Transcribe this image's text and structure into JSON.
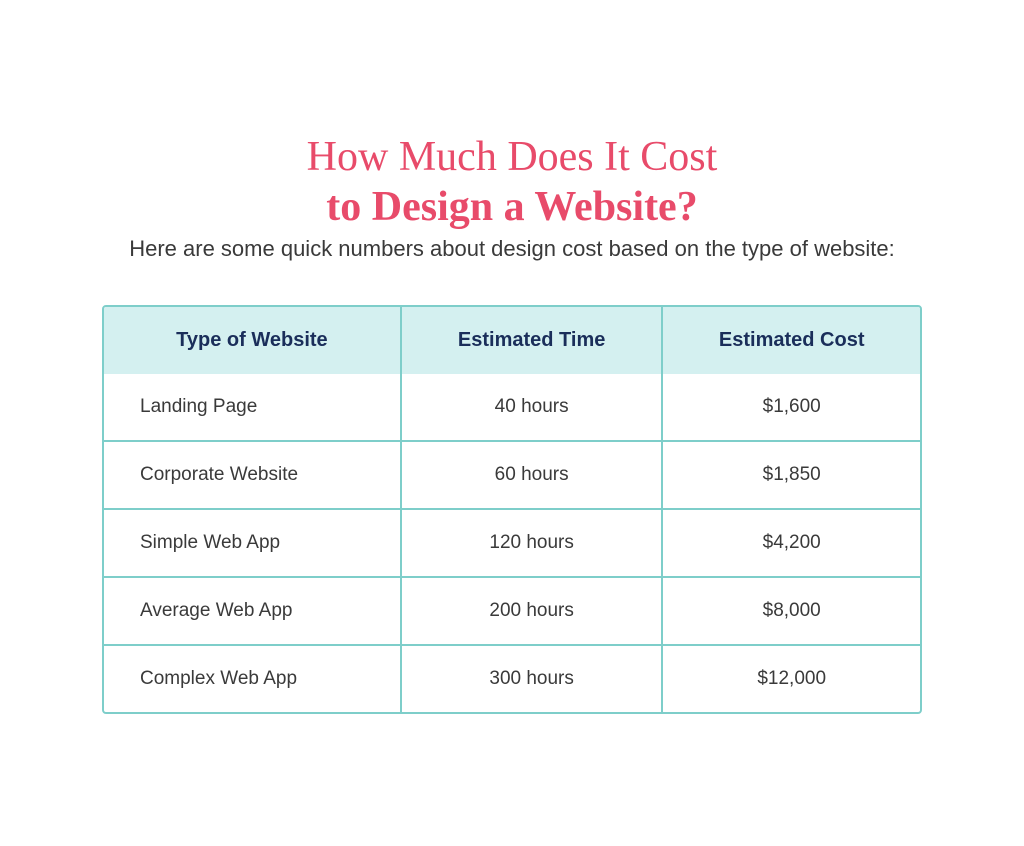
{
  "header": {
    "title_line1": "How Much Does It Cost",
    "title_line2": "to Design a Website?",
    "subtitle": "Here are some quick numbers about design cost based on the type of website:"
  },
  "table": {
    "columns": [
      {
        "label": "Type of Website"
      },
      {
        "label": "Estimated Time"
      },
      {
        "label": "Estimated Cost"
      }
    ],
    "rows": [
      {
        "type": "Landing Page",
        "time": "40 hours",
        "cost": "$1,600"
      },
      {
        "type": "Corporate Website",
        "time": "60 hours",
        "cost": "$1,850"
      },
      {
        "type": "Simple Web App",
        "time": "120 hours",
        "cost": "$4,200"
      },
      {
        "type": "Average Web App",
        "time": "200 hours",
        "cost": "$8,000"
      },
      {
        "type": "Complex Web App",
        "time": "300 hours",
        "cost": "$12,000"
      }
    ]
  }
}
